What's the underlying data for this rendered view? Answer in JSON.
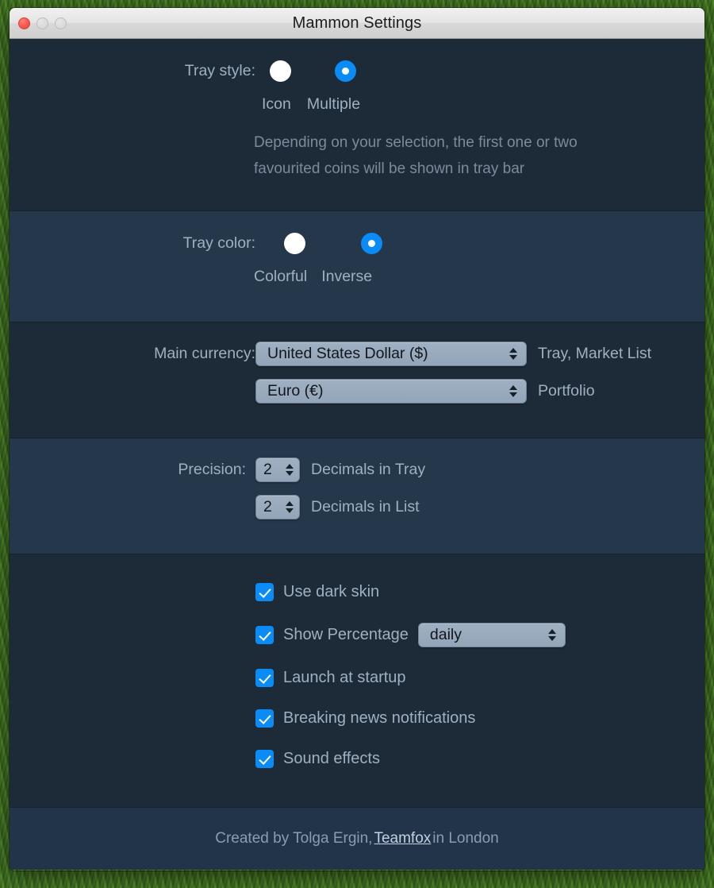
{
  "window": {
    "title": "Mammon Settings",
    "controls": {
      "close": "close",
      "minimize": "minimize",
      "maximize": "maximize"
    }
  },
  "accent_colors": {
    "selected_blue": "#0b8bf5",
    "section_dark": "#1d2b39",
    "section_light": "#25374b",
    "label_text": "#9fb0c0",
    "muted_text": "#7b8b9b"
  },
  "tray_style": {
    "label": "Tray style:",
    "options": [
      {
        "label": "Icon",
        "selected": false
      },
      {
        "label": "Multiple",
        "selected": true
      }
    ],
    "description_line1": "Depending on your selection, the first one or two",
    "description_line2": "favourited coins will be shown in tray bar"
  },
  "tray_color": {
    "label": "Tray color:",
    "options": [
      {
        "label": "Colorful",
        "selected": false
      },
      {
        "label": "Inverse",
        "selected": true
      }
    ]
  },
  "main_currency": {
    "label": "Main currency:",
    "primary": {
      "value": "United States Dollar ($)",
      "hint": "Tray, Market List"
    },
    "secondary": {
      "value": "Euro (€)",
      "hint": "Portfolio"
    }
  },
  "precision": {
    "label": "Precision:",
    "tray": {
      "value": "2",
      "hint": "Decimals in Tray"
    },
    "list": {
      "value": "2",
      "hint": "Decimals in List"
    }
  },
  "toggles": {
    "dark_skin": {
      "label": "Use dark skin",
      "checked": true
    },
    "show_percentage": {
      "label": "Show Percentage",
      "checked": true,
      "period_value": "daily"
    },
    "launch_at_startup": {
      "label": "Launch at startup",
      "checked": true
    },
    "breaking_news": {
      "label": "Breaking news notifications",
      "checked": true
    },
    "sound_effects": {
      "label": "Sound effects",
      "checked": true
    }
  },
  "footer": {
    "prefix": "Created by Tolga Ergin,",
    "link": "Teamfox",
    "suffix": "in London"
  }
}
